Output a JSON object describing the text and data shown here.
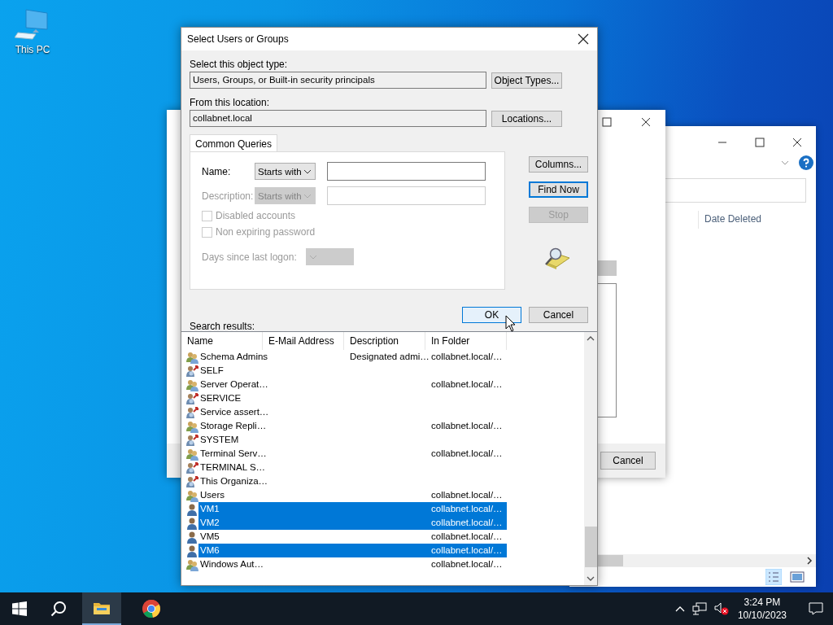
{
  "desktop": {
    "icons": [
      {
        "label": "This PC"
      }
    ]
  },
  "background_windows": {
    "dialog_buttons": [
      "Cancel"
    ],
    "explorer": {
      "column_header": "Date Deleted"
    }
  },
  "dialog": {
    "title": "Select Users or Groups",
    "object_type": {
      "label": "Select this object type:",
      "value": "Users, Groups, or Built-in security principals",
      "button": "Object Types..."
    },
    "location": {
      "label": "From this location:",
      "value": "collabnet.local",
      "button": "Locations..."
    },
    "tabs": [
      {
        "label": "Common Queries",
        "selected": true
      }
    ],
    "query": {
      "fields": [
        {
          "label": "Name:",
          "operator": "Starts with",
          "disabled": false
        },
        {
          "label": "Description:",
          "operator": "Starts with",
          "disabled": true
        }
      ],
      "checkboxes": [
        {
          "label": "Disabled accounts",
          "checked": false,
          "disabled": true
        },
        {
          "label": "Non expiring password",
          "checked": false,
          "disabled": true
        }
      ],
      "days": {
        "label": "Days since last logon:",
        "disabled": true
      }
    },
    "side_buttons": [
      {
        "label": "Columns...",
        "disabled": false,
        "default": false
      },
      {
        "label": "Find Now",
        "disabled": false,
        "default": true
      },
      {
        "label": "Stop",
        "disabled": true,
        "default": false
      }
    ],
    "action_buttons": [
      {
        "label": "OK",
        "hovered": true
      },
      {
        "label": "Cancel",
        "hovered": false
      }
    ],
    "results": {
      "label": "Search results:",
      "columns": [
        "Name",
        "E-Mail Address",
        "Description",
        "In Folder"
      ],
      "rows": [
        {
          "kind": "group",
          "name": "Schema Admins",
          "description": "Designated admi…",
          "folder": "collabnet.local/…",
          "selected": false
        },
        {
          "kind": "special",
          "name": "SELF",
          "selected": false
        },
        {
          "kind": "group",
          "name": "Server Operat…",
          "folder": "collabnet.local/…",
          "selected": false
        },
        {
          "kind": "special",
          "name": "SERVICE",
          "selected": false
        },
        {
          "kind": "special",
          "name": "Service assert…",
          "selected": false
        },
        {
          "kind": "group",
          "name": "Storage Repli…",
          "folder": "collabnet.local/…",
          "selected": false
        },
        {
          "kind": "special",
          "name": "SYSTEM",
          "selected": false
        },
        {
          "kind": "group",
          "name": "Terminal Serv…",
          "folder": "collabnet.local/…",
          "selected": false
        },
        {
          "kind": "special",
          "name": "TERMINAL S…",
          "selected": false
        },
        {
          "kind": "special",
          "name": "This Organiza…",
          "selected": false
        },
        {
          "kind": "group",
          "name": "Users",
          "folder": "collabnet.local/…",
          "selected": false
        },
        {
          "kind": "user",
          "name": "VM1",
          "folder": "collabnet.local/…",
          "selected": true
        },
        {
          "kind": "user",
          "name": "VM2",
          "folder": "collabnet.local/…",
          "selected": true
        },
        {
          "kind": "user",
          "name": "VM5",
          "folder": "collabnet.local/…",
          "selected": false
        },
        {
          "kind": "user",
          "name": "VM6",
          "folder": "collabnet.local/…",
          "selected": true
        },
        {
          "kind": "group",
          "name": "Windows Aut…",
          "folder": "collabnet.local/…",
          "selected": false
        }
      ]
    }
  },
  "taskbar": {
    "clock": {
      "time": "3:24 PM",
      "date": "10/10/2023"
    }
  }
}
